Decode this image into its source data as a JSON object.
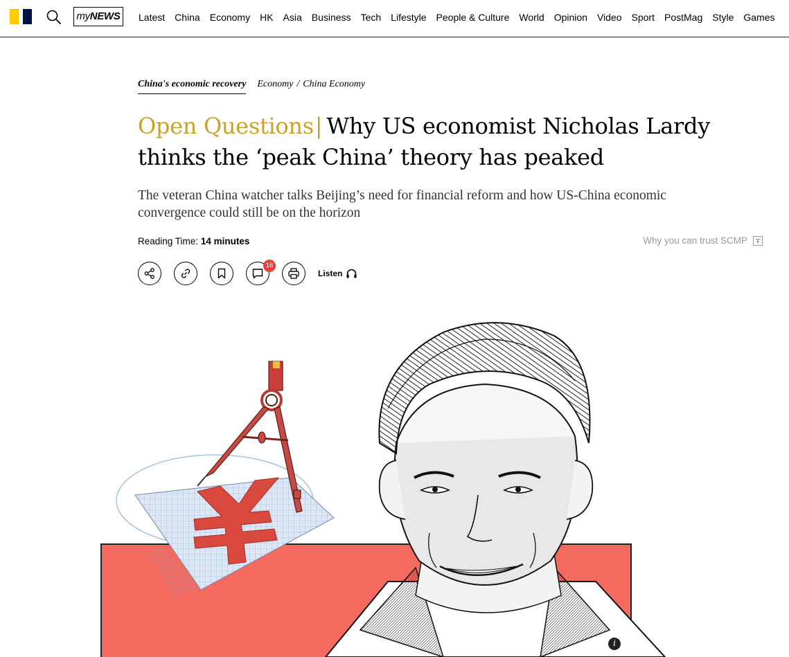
{
  "nav": {
    "mynews_prefix": "my",
    "mynews_suffix": "NEWS",
    "items": [
      "Latest",
      "China",
      "Economy",
      "HK",
      "Asia",
      "Business",
      "Tech",
      "Lifestyle",
      "People & Culture",
      "World",
      "Opinion",
      "Video",
      "Sport",
      "PostMag",
      "Style",
      "Games"
    ]
  },
  "article": {
    "topic": "China's economic recovery",
    "section": "Economy",
    "subsection": "China Economy",
    "series": "Open Questions",
    "separator": "|",
    "headline": "Why US economist Nicholas Lardy thinks the ‘peak China’ theory has peaked",
    "subhead": "The veteran China watcher talks Beijing’s need for financial reform and how US-China economic convergence could still be on the horizon",
    "reading_label": "Reading Time:",
    "reading_value": "14 minutes",
    "trust_text": "Why you can trust SCMP"
  },
  "actions": {
    "comment_count": "16",
    "listen_label": "Listen"
  },
  "hero": {
    "info_glyph": "i"
  },
  "colors": {
    "brand_yellow": "#FFCA05",
    "brand_navy": "#001246",
    "series_gold": "#C9A227",
    "badge_red": "#E5413A",
    "hero_coral": "#F46A5E"
  },
  "icons": [
    "scmp-logo",
    "search-icon",
    "share-icon",
    "link-icon",
    "bookmark-icon",
    "comment-icon",
    "print-icon",
    "headphones-icon",
    "trust-icon",
    "info-icon"
  ]
}
